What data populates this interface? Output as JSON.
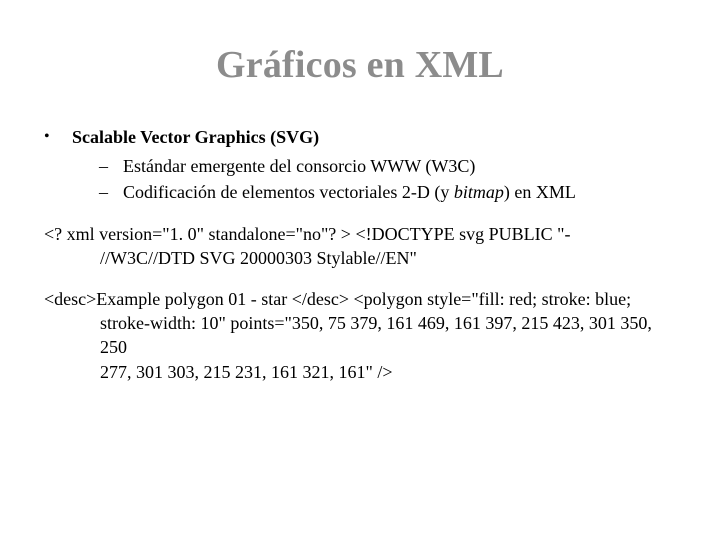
{
  "title": "Gráficos en XML",
  "bullets": {
    "item1": "Scalable Vector Graphics (SVG)",
    "sub1_a": "Estándar emergente del consorcio WWW (W3C)",
    "sub2_prefix": "Codificación de elementos vectoriales 2-D (y ",
    "sub2_italic": "bitmap",
    "sub2_suffix": ") en XML"
  },
  "code": {
    "p1_line1": "<? xml version=\"1. 0\" standalone=\"no\"? > <!DOCTYPE svg PUBLIC \"-",
    "p1_line2": "//W3C//DTD SVG 20000303 Stylable//EN\"",
    "p2_line1": "<desc>Example polygon 01 - star </desc> <polygon style=\"fill: red; stroke: blue;",
    "p2_line2": "stroke-width: 10\" points=\"350, 75 379, 161 469, 161 397, 215 423, 301 350, 250",
    "p2_line3": "277, 301 303, 215 231, 161 321, 161\" />"
  }
}
